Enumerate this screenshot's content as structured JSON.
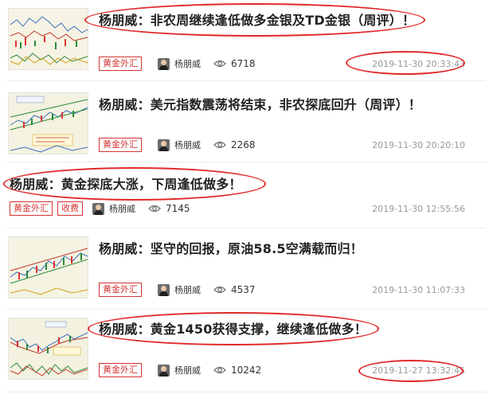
{
  "articles": [
    {
      "title": "杨朋威：非农周继续逢低做多金银及TD金银（周评）！",
      "tags": [
        "黄金外汇"
      ],
      "author": "杨朋威",
      "views": "6718",
      "time": "2019-11-30 20:33:43"
    },
    {
      "title": "杨朋威：美元指数震荡将结束，非农探底回升（周评）！",
      "tags": [
        "黄金外汇"
      ],
      "author": "杨朋威",
      "views": "2268",
      "time": "2019-11-30 20:20:10"
    },
    {
      "title": "杨朋威：黄金探底大涨，下周逢低做多！",
      "tags": [
        "黄金外汇",
        "收费"
      ],
      "author": "杨朋威",
      "views": "7145",
      "time": "2019-11-30 12:55:56"
    },
    {
      "title": "杨朋威：坚守的回报，原油58.5空满载而归！",
      "tags": [
        "黄金外汇"
      ],
      "author": "杨朋威",
      "views": "4537",
      "time": "2019-11-30 11:07:33"
    },
    {
      "title": "杨朋威：黄金1450获得支撑，继续逢低做多！",
      "tags": [
        "黄金外汇"
      ],
      "author": "杨朋威",
      "views": "10242",
      "time": "2019-11-27 13:32:45"
    }
  ],
  "icons": {
    "avatar": "author-avatar",
    "views": "eye-icon"
  },
  "colors": {
    "tag": "#d43333",
    "annotation": "#e02a2a",
    "time": "#999999"
  }
}
